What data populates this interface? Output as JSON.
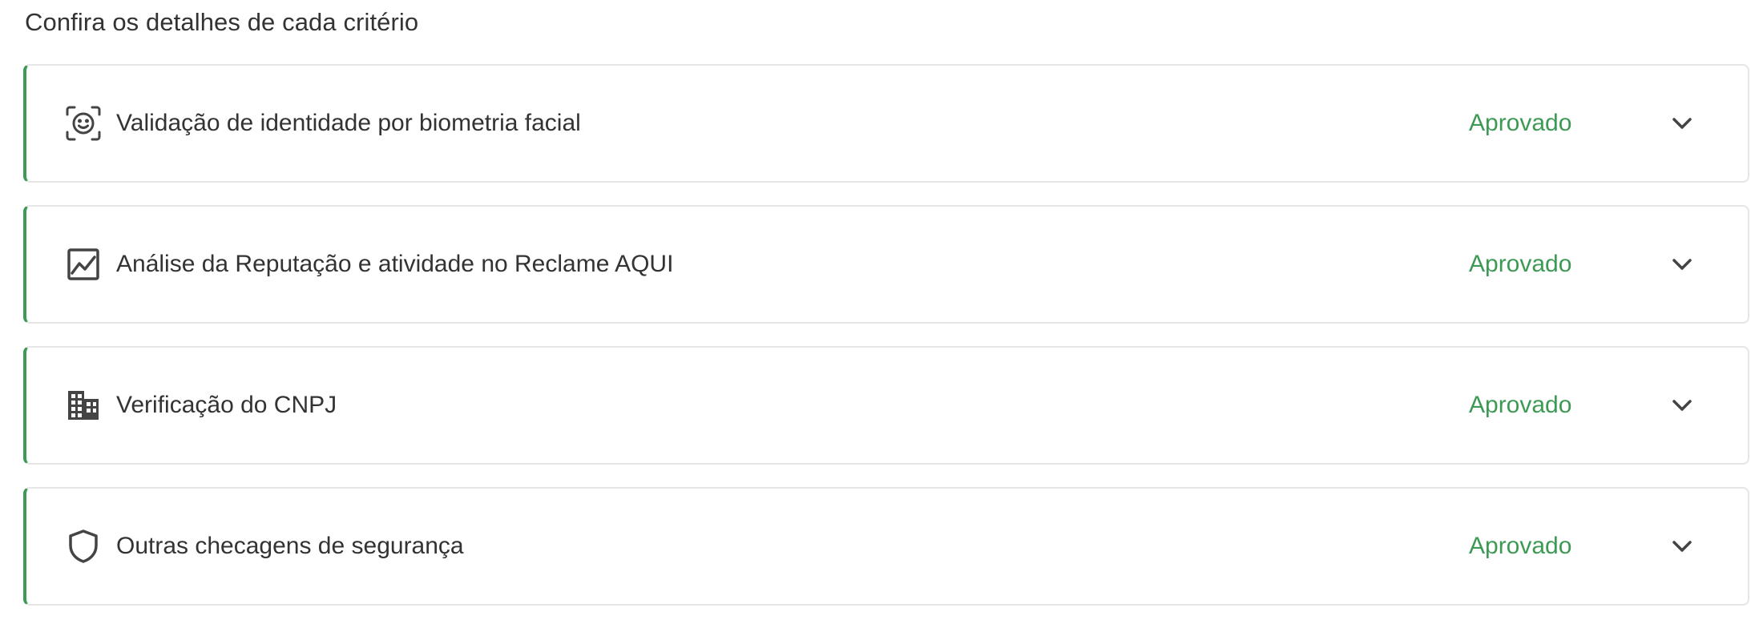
{
  "section": {
    "title": "Confira os detalhes de cada critério"
  },
  "colors": {
    "accent_green": "#3d9a54",
    "text": "#333333",
    "border": "#e6e6e6",
    "icon": "#444444"
  },
  "criteria": [
    {
      "icon": "face-id-icon",
      "label": "Validação de identidade por biometria facial",
      "status": "Aprovado"
    },
    {
      "icon": "chart-line-icon",
      "label": "Análise da Reputação e atividade no Reclame AQUI",
      "status": "Aprovado"
    },
    {
      "icon": "building-icon",
      "label": "Verificação do CNPJ",
      "status": "Aprovado"
    },
    {
      "icon": "shield-icon",
      "label": "Outras checagens de segurança",
      "status": "Aprovado"
    }
  ]
}
